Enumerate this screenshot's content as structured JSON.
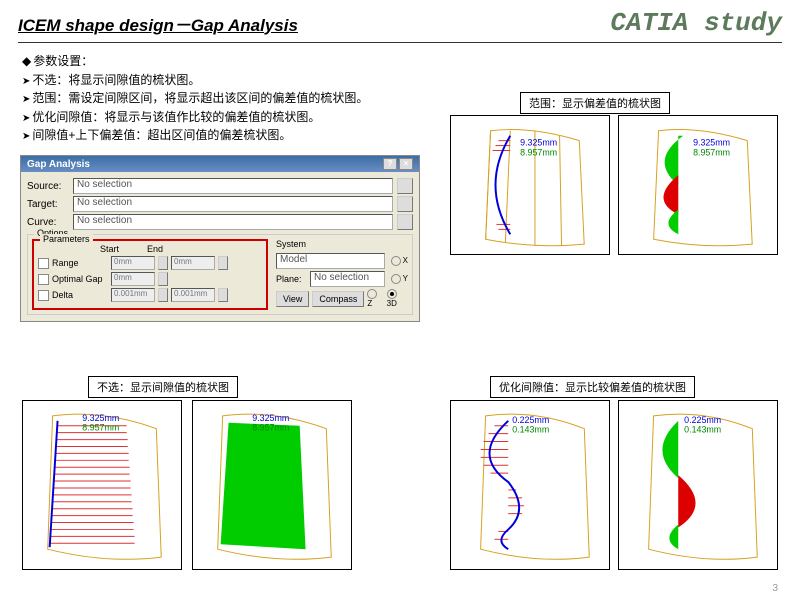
{
  "header": {
    "title": "ICEM shape design－Gap Analysis",
    "brand": "CATIA study"
  },
  "bullets": {
    "b0": "参数设置：",
    "b1": "不选：将显示间隙值的梳状图。",
    "b2": "范围：需设定间隙区间，将显示超出该区间的偏差值的梳状图。",
    "b3": "优化间隙值：将显示与该值作比较的偏差值的梳状图。",
    "b4": "间隙值+上下偏差值：超出区间值的偏差梳状图。"
  },
  "dialog": {
    "title": "Gap Analysis",
    "help": "?",
    "close": "×",
    "source": "Source:",
    "target": "Target:",
    "curve": "Curve:",
    "no_selection": "No selection",
    "options": "Options",
    "parameters": "Parameters",
    "start": "Start",
    "end": "End",
    "range": "Range",
    "range_start": "0mm",
    "range_end": "0mm",
    "optimal": "Optimal Gap",
    "optimal_v": "0mm",
    "delta": "Delta",
    "delta_start": "0.001mm",
    "delta_end": "0.001mm",
    "system": "System",
    "model": "Model",
    "plane": "Plane:",
    "view": "View",
    "compass": "Compass",
    "x": "X",
    "y": "Y",
    "z": "Z",
    "threeD": "3D"
  },
  "captions": {
    "c_range": "范围：显示偏差值的梳状图",
    "c_none": "不选：显示间隙值的梳状图",
    "c_opt": "优化间隙值：显示比较偏差值的梳状图"
  },
  "measurements": {
    "m1": "9.325mm",
    "m1b": "8.957mm",
    "m2": "0.225mm",
    "m2b": "0.143mm"
  },
  "page": "3"
}
